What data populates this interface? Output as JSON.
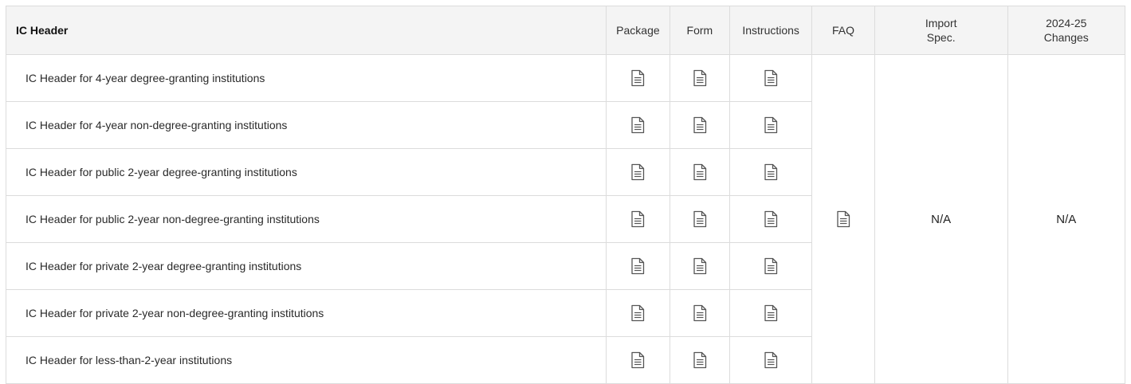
{
  "table": {
    "headers": {
      "title": "IC Header",
      "package": "Package",
      "form": "Form",
      "instructions": "Instructions",
      "faq": "FAQ",
      "import_spec": "Import\nSpec.",
      "changes": "2024-25\nChanges"
    },
    "rows": [
      {
        "label": "IC Header for 4-year degree-granting institutions"
      },
      {
        "label": "IC Header for 4-year non-degree-granting institutions"
      },
      {
        "label": "IC Header for public 2-year degree-granting institutions"
      },
      {
        "label": "IC Header for public 2-year non-degree-granting institutions"
      },
      {
        "label": "IC Header for private 2-year degree-granting institutions"
      },
      {
        "label": "IC Header for private 2-year non-degree-granting institutions"
      },
      {
        "label": "IC Header for less-than-2-year institutions"
      }
    ],
    "faq_icon": "document-icon",
    "import_spec_value": "N/A",
    "changes_value": "N/A"
  },
  "colors": {
    "border": "#dcdcdc",
    "header_bg": "#f4f4f4",
    "icon": "#555555"
  }
}
